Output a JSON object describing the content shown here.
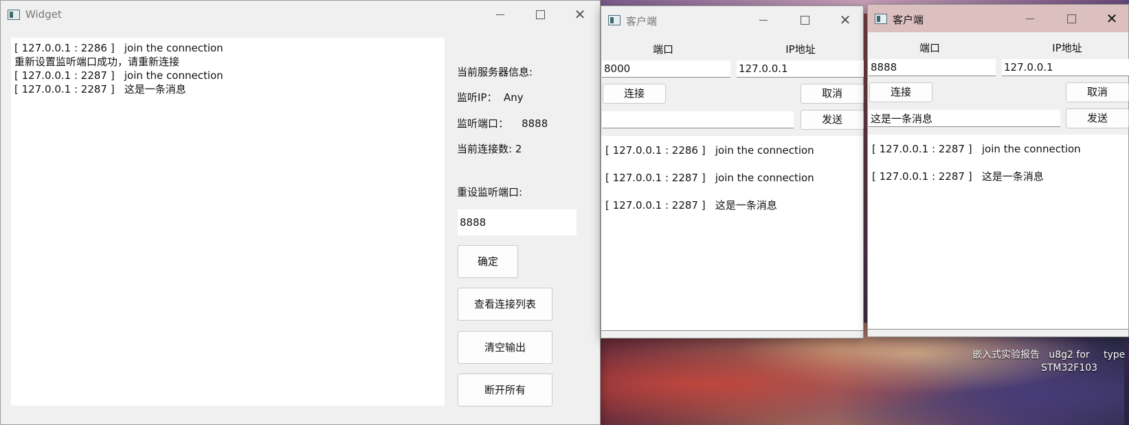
{
  "desktop": {
    "icons": [
      {
        "label": "嵌入式实验报告"
      },
      {
        "label": "u8g2 for STM32F103"
      },
      {
        "label": "type"
      }
    ]
  },
  "server_window": {
    "title": "Widget",
    "log_lines": [
      "[ 127.0.0.1 : 2286 ]   join the connection",
      "重新设置监听端口成功，请重新连接",
      "[ 127.0.0.1 : 2287 ]   join the connection",
      "[ 127.0.0.1 : 2287 ]   这是一条消息"
    ],
    "info_header": "当前服务器信息:",
    "listen_ip_label": "监听IP：  Any",
    "listen_port_label": "监听端口：    8888",
    "connection_count_label": "当前连接数: 2",
    "reset_port_label": "重设监听端口:",
    "reset_port_value": "8888",
    "confirm_button": "确定",
    "view_connections_button": "查看连接列表",
    "clear_output_button": "清空输出",
    "disconnect_all_button": "断开所有"
  },
  "client1": {
    "title": "客户端",
    "port_label": "端口",
    "ip_label": "IP地址",
    "port_value": "8000",
    "ip_value": "127.0.0.1",
    "connect_button": "连接",
    "cancel_button": "取消",
    "message_value": "",
    "send_button": "发送",
    "log_lines": [
      "[ 127.0.0.1 : 2286 ]   join the connection",
      "[ 127.0.0.1 : 2287 ]   join the connection",
      "[ 127.0.0.1 : 2287 ]   这是一条消息"
    ]
  },
  "client2": {
    "title": "客户端",
    "port_label": "端口",
    "ip_label": "IP地址",
    "port_value": "8888",
    "ip_value": "127.0.0.1",
    "connect_button": "连接",
    "cancel_button": "取消",
    "message_value": "这是一条消息",
    "send_button": "发送",
    "log_lines": [
      "[ 127.0.0.1 : 2287 ]   join the connection",
      "[ 127.0.0.1 : 2287 ]   这是一条消息"
    ]
  }
}
